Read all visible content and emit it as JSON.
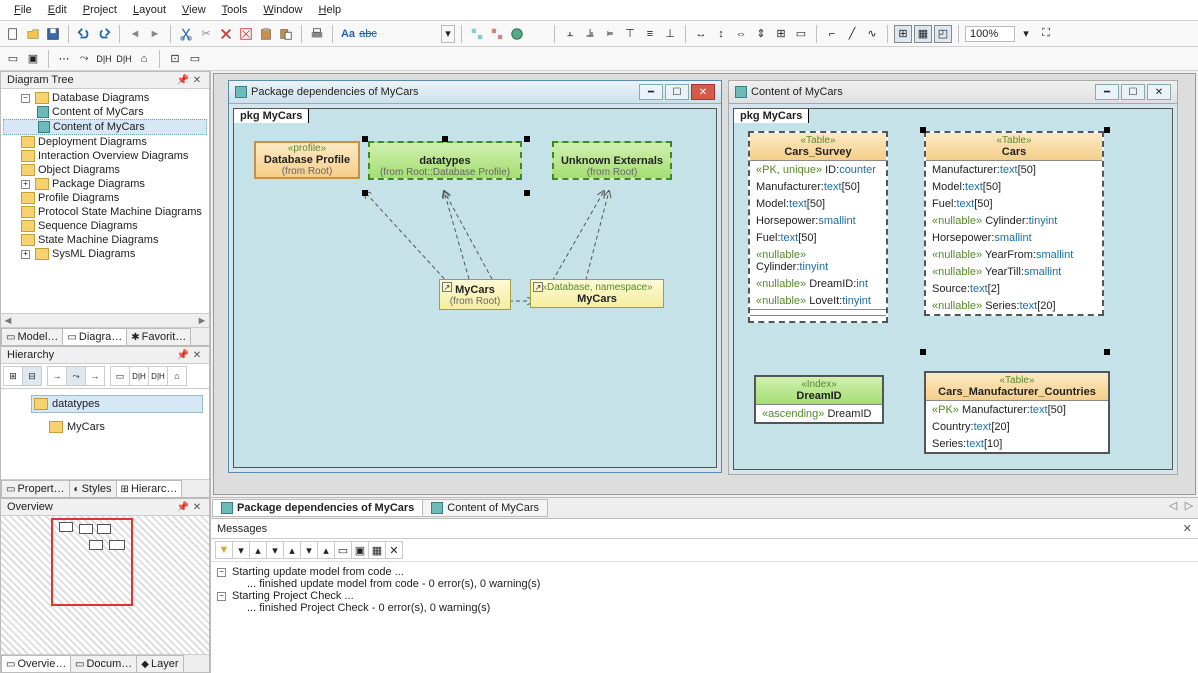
{
  "menu": [
    "File",
    "Edit",
    "Project",
    "Layout",
    "View",
    "Tools",
    "Window",
    "Help"
  ],
  "zoom": "100%",
  "panels": {
    "diagram_tree": {
      "title": "Diagram Tree"
    },
    "hierarchy": {
      "title": "Hierarchy"
    },
    "overview": {
      "title": "Overview"
    },
    "messages": {
      "title": "Messages"
    }
  },
  "tree": {
    "root": "Database Diagrams",
    "items": [
      {
        "label": "Content of MyCars",
        "type": "diag"
      },
      {
        "label": "Content of MyCars",
        "type": "diag",
        "sel": true
      },
      {
        "label": "Deployment Diagrams",
        "type": "folder"
      },
      {
        "label": "Interaction Overview Diagrams",
        "type": "folder"
      },
      {
        "label": "Object Diagrams",
        "type": "folder"
      },
      {
        "label": "Package Diagrams",
        "type": "folder",
        "expand": true
      },
      {
        "label": "Profile Diagrams",
        "type": "folder"
      },
      {
        "label": "Protocol State Machine Diagrams",
        "type": "folder"
      },
      {
        "label": "Sequence Diagrams",
        "type": "folder"
      },
      {
        "label": "State Machine Diagrams",
        "type": "folder"
      },
      {
        "label": "SysML Diagrams",
        "type": "folder",
        "expand": true
      }
    ]
  },
  "tree_tabs": [
    "Model…",
    "Diagra…",
    "Favorit…"
  ],
  "hier_items": [
    "datatypes",
    "MyCars"
  ],
  "prop_tabs": [
    "Propert…",
    "Styles",
    "Hierarc…"
  ],
  "ov_tabs": [
    "Overvie…",
    "Docum…",
    "Layer"
  ],
  "win1": {
    "title": "Package dependencies of MyCars",
    "pkg": "pkg MyCars",
    "boxes": {
      "dbprofile": {
        "stereo": "«profile»",
        "name": "Database Profile",
        "from": "(from Root)"
      },
      "datatypes": {
        "name": "datatypes",
        "from": "(from Root::Database Profile)"
      },
      "unknown": {
        "name": "Unknown Externals",
        "from": "(from Root)"
      },
      "mycars1": {
        "name": "MyCars",
        "from": "(from Root)"
      },
      "mycars2": {
        "stereo": "«Database, namespace»",
        "name": "MyCars"
      }
    }
  },
  "win2": {
    "title": "Content of MyCars",
    "pkg": "pkg MyCars",
    "tables": {
      "survey": {
        "stereo": "«Table»",
        "name": "Cars_Survey",
        "rows": [
          {
            "kw": "«PK, unique»",
            "n": "ID",
            "t": "counter"
          },
          {
            "kw": "",
            "n": "Manufacturer",
            "t": "text",
            "len": "[50]"
          },
          {
            "kw": "",
            "n": "Model",
            "t": "text",
            "len": "[50]"
          },
          {
            "kw": "",
            "n": "Horsepower",
            "t": "smallint"
          },
          {
            "kw": "",
            "n": "Fuel",
            "t": "text",
            "len": "[50]"
          },
          {
            "kw": "«nullable»",
            "n": "Cylinder",
            "t": "tinyint"
          },
          {
            "kw": "«nullable»",
            "n": "DreamID",
            "t": "int"
          },
          {
            "kw": "«nullable»",
            "n": "LoveIt",
            "t": "tinyint"
          }
        ]
      },
      "cars": {
        "stereo": "«Table»",
        "name": "Cars",
        "rows": [
          {
            "kw": "",
            "n": "Manufacturer",
            "t": "text",
            "len": "[50]"
          },
          {
            "kw": "",
            "n": "Model",
            "t": "text",
            "len": "[50]"
          },
          {
            "kw": "",
            "n": "Fuel",
            "t": "text",
            "len": "[50]"
          },
          {
            "kw": "«nullable»",
            "n": "Cylinder",
            "t": "tinyint"
          },
          {
            "kw": "",
            "n": "Horsepower",
            "t": "smallint"
          },
          {
            "kw": "«nullable»",
            "n": "YearFrom",
            "t": "smallint"
          },
          {
            "kw": "«nullable»",
            "n": "YearTill",
            "t": "smallint"
          },
          {
            "kw": "",
            "n": "Source",
            "t": "text",
            "len": "[2]"
          },
          {
            "kw": "«nullable»",
            "n": "Series",
            "t": "text",
            "len": "[20]"
          }
        ]
      },
      "dreamid": {
        "stereo": "«Index»",
        "name": "DreamID",
        "rows": [
          {
            "kw": "«ascending»",
            "n": "DreamID",
            "t": ""
          }
        ]
      },
      "cmc": {
        "stereo": "«Table»",
        "name": "Cars_Manufacturer_Countries",
        "rows": [
          {
            "kw": "«PK»",
            "n": "Manufacturer",
            "t": "text",
            "len": "[50]"
          },
          {
            "kw": "",
            "n": "Country",
            "t": "text",
            "len": "[20]"
          },
          {
            "kw": "",
            "n": "Series",
            "t": "text",
            "len": "[10]"
          }
        ]
      }
    }
  },
  "doc_tabs": [
    {
      "label": "Package dependencies of MyCars",
      "active": true
    },
    {
      "label": "Content of MyCars",
      "active": false
    }
  ],
  "messages": [
    {
      "expand": true,
      "text": "Starting update model from code ..."
    },
    {
      "indent": true,
      "text": "... finished update model from code - 0 error(s), 0 warning(s)"
    },
    {
      "expand": true,
      "text": "Starting Project Check ..."
    },
    {
      "indent": true,
      "text": "... finished Project Check - 0 error(s), 0 warning(s)"
    }
  ]
}
